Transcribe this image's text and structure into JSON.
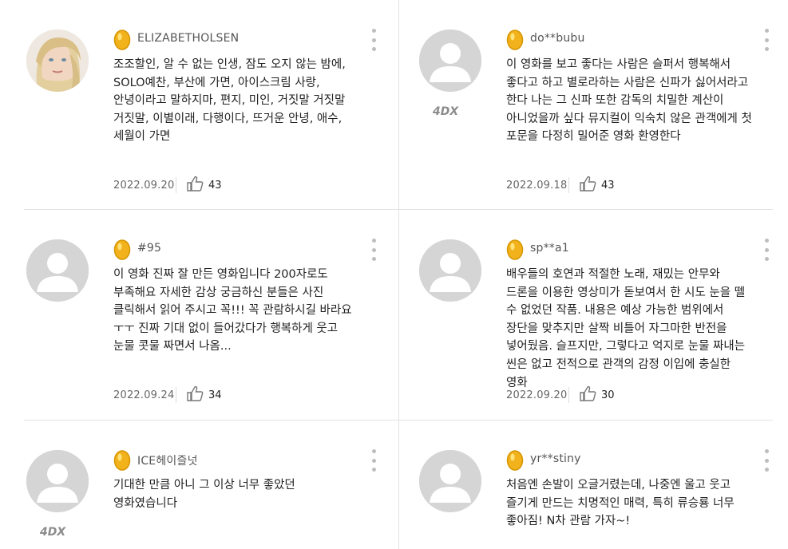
{
  "reviews": [
    {
      "username": "ELIZABETHOLSEN",
      "text": "조조할인, 알 수 없는 인생, 잠도 오지 않는 밤에, SOLO예찬, 부산에 가면, 아이스크림 사랑, 안녕이라고 말하지마, 편지, 미인, 거짓말 거짓말 거짓말, 이별이래, 다행이다, 뜨거운 안녕, 애수, 세월이 가면",
      "date": "2022.09.20",
      "likes": "43",
      "avatar": "photo-woman-blonde",
      "badge": ""
    },
    {
      "username": "do**bubu",
      "text": "이 영화를 보고 좋다는 사람은 슬퍼서 행복해서 좋다고 하고 별로라하는 사람은 신파가 싫어서라고 한다 나는 그 신파 또한 감독의 치밀한 계산이 아니었을까 싶다 뮤지컬이 익숙치 않은 관객에게 첫 포문을 다정히 밀어준 영화 환영한다",
      "date": "2022.09.18",
      "likes": "43",
      "avatar": "default-avatar",
      "badge": "4DX"
    },
    {
      "username": "#95",
      "text": "이 영화 진짜 잘 만든 영화입니다 200자로도 부족해요 자세한 감상 궁금하신 분들은 사진 클릭해서 읽어 주시고 꼭!!! 꼭 관람하시길 바라요 ㅜㅜ 진짜 기대 없이 들어갔다가 행복하게 웃고 눈물 콧물 짜면서 나옴...",
      "date": "2022.09.24",
      "likes": "34",
      "avatar": "default-avatar",
      "badge": ""
    },
    {
      "username": "sp**a1",
      "text": "배우들의 호연과 적절한 노래, 재밌는 안무와 드론을 이용한 영상미가 돋보여서 한 시도 눈을 뗄 수 없었던 작품. 내용은 예상 가능한 범위에서 장단을 맞추지만 살짝 비틀어 자그마한 반전을 넣어뒀음. 슬프지만, 그렇다고 억지로 눈물 짜내는 씬은 없고 전적으로 관객의 감정 이입에 충실한 영화",
      "date": "2022.09.20",
      "likes": "30",
      "avatar": "default-avatar",
      "badge": ""
    },
    {
      "username": "ICE헤이즐넛",
      "text": "기대한 만큼 아니 그 이상 너무 좋았던 영화였습니다",
      "date": "",
      "likes": "",
      "avatar": "default-avatar",
      "badge": "4DX"
    },
    {
      "username": "yr**stiny",
      "text": "처음엔 손발이 오글거렸는데, 나중엔 울고 웃고 즐기게 만드는 치명적인 매력, 특히 류승룡 너무 좋아짐! N차 관람 가자~!",
      "date": "",
      "likes": "",
      "avatar": "default-avatar",
      "badge": ""
    }
  ],
  "colors": {
    "egg": "#f2b21c",
    "divider": "#e3e3e3",
    "avatar_bg": "#d5d5d5",
    "text": "#222222"
  },
  "icons": {
    "grade": "golden-egg-icon",
    "more": "more-vertical-icon",
    "like": "thumbs-up-icon"
  }
}
